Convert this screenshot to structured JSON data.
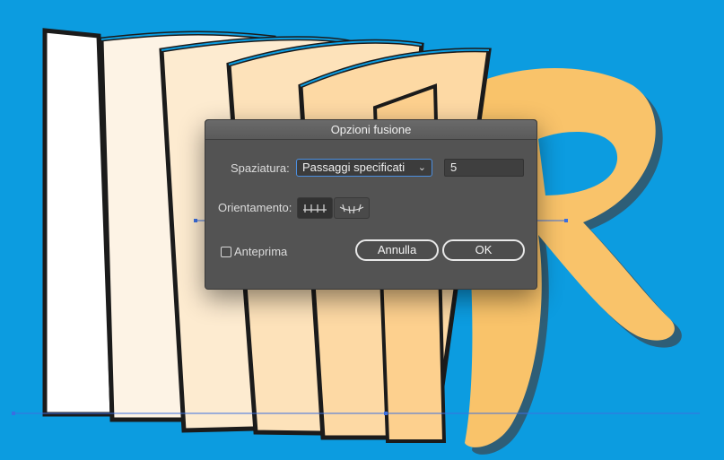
{
  "dialog": {
    "title": "Opzioni fusione",
    "spacing_label": "Spaziatura:",
    "spacing_value": "Passaggi specificati",
    "steps_value": "5",
    "orientation_label": "Orientamento:",
    "orientation_options": [
      "align-to-page-icon",
      "align-to-path-icon"
    ],
    "preview_label": "Anteprima",
    "preview_checked": false,
    "cancel_label": "Annulla",
    "ok_label": "OK"
  },
  "canvas": {
    "background_color": "#0c9ce0",
    "page_colors": [
      "#ffffff",
      "#fdf3e5",
      "#fdebd0",
      "#fde2ba",
      "#fdd9a4",
      "#fdd08e"
    ],
    "letter": "R",
    "letter_color": "#f9c36a"
  }
}
